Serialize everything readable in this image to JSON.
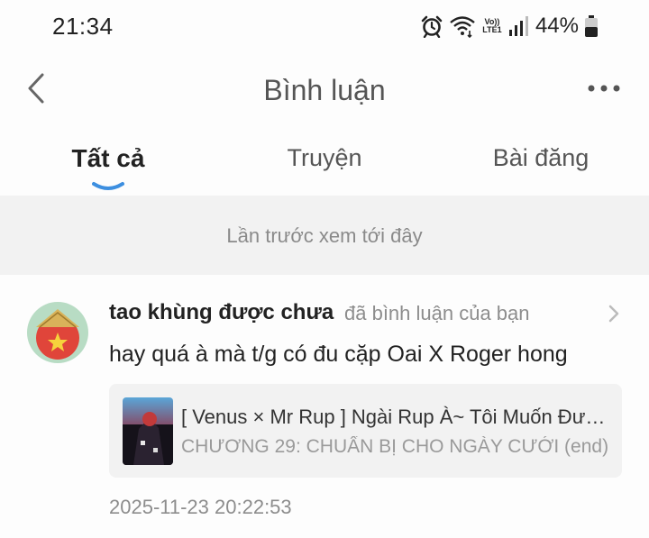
{
  "status_bar": {
    "time": "21:34",
    "lte_line1": "Vo))",
    "lte_line2": "LTE1",
    "battery": "44%",
    "icons": [
      "alarm-icon",
      "wifi-icon",
      "signal-icon",
      "battery-icon"
    ]
  },
  "header": {
    "title": "Bình luận",
    "back_icon": "chevron-left-icon",
    "more_icon": "more-horizontal-icon"
  },
  "tabs": [
    {
      "label": "Tất cả",
      "active": true
    },
    {
      "label": "Truyện",
      "active": false
    },
    {
      "label": "Bài đăng",
      "active": false
    }
  ],
  "notice": "Lần trước xem tới đây",
  "comment": {
    "user_name": "tao khùng được chưa",
    "action": "đã bình luận của bạn",
    "text": "hay quá à mà t/g có đu cặp Oai X Roger hong",
    "story": {
      "title": "[ Venus × Mr Rup ] Ngài Rup À~ Tôi Muốn Được Gả Cho Ngài",
      "chapter": "CHƯƠNG 29: CHUẨN BỊ CHO NGÀY CƯỚI (end)"
    },
    "timestamp": "2025-11-23 20:22:53"
  },
  "colors": {
    "accent": "#3d8fe0",
    "notice_bg": "#f2f2f2",
    "card_bg": "#f2f2f2",
    "muted_text": "#8d8d8d"
  }
}
